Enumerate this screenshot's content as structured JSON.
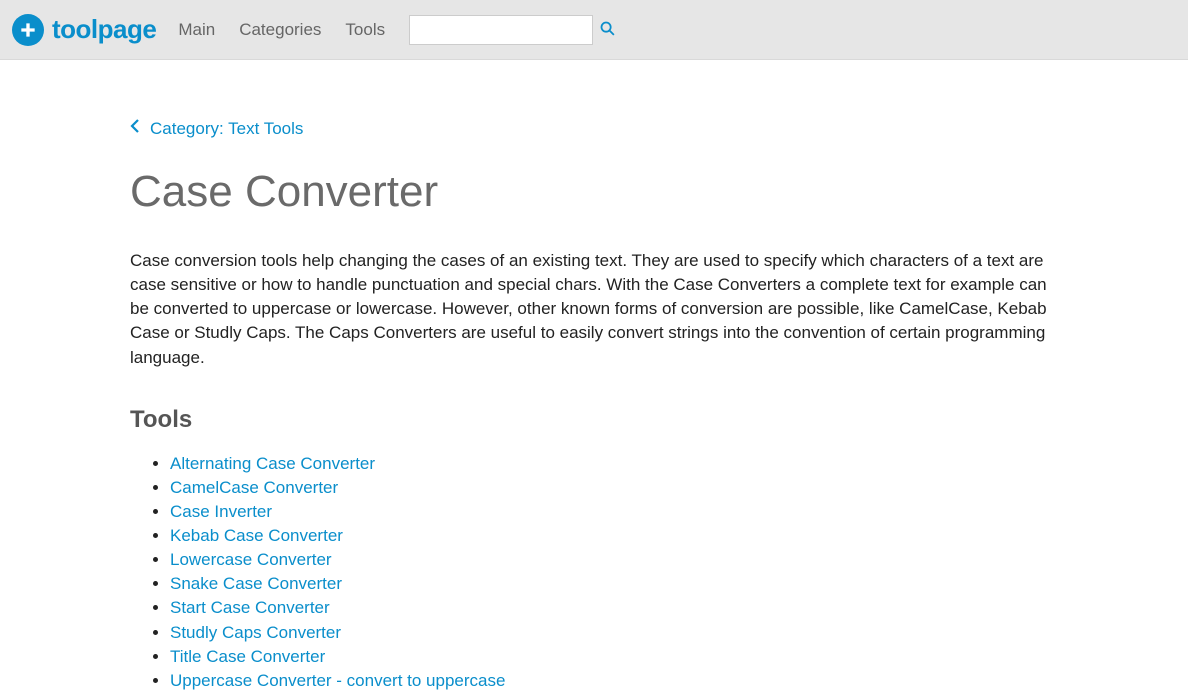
{
  "brand": "toolpage",
  "nav": {
    "main": "Main",
    "categories": "Categories",
    "tools": "Tools"
  },
  "search": {
    "value": "",
    "placeholder": ""
  },
  "breadcrumb": {
    "label": "Category: Text Tools"
  },
  "page": {
    "title": "Case Converter",
    "description": "Case conversion tools help changing the cases of an existing text. They are used to specify which characters of a text are case sensitive or how to handle punctuation and special chars. With the Case Converters a complete text for example can be converted to uppercase or lowercase. However, other known forms of conversion are possible, like CamelCase, Kebab Case or Studly Caps. The Caps Converters are useful to easily convert strings into the convention of certain programming language."
  },
  "tools": {
    "heading": "Tools",
    "items": [
      "Alternating Case Converter",
      "CamelCase Converter",
      "Case Inverter",
      "Kebab Case Converter",
      "Lowercase Converter",
      "Snake Case Converter",
      "Start Case Converter",
      "Studly Caps Converter",
      "Title Case Converter",
      "Uppercase Converter - convert to uppercase"
    ]
  }
}
